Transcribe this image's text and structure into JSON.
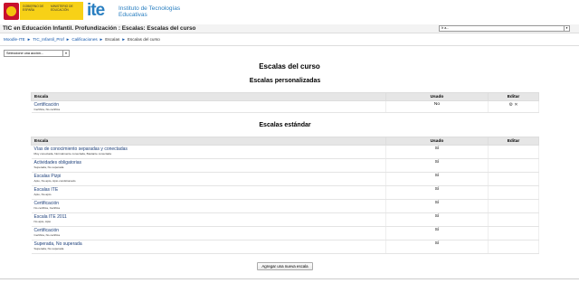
{
  "header": {
    "gov_text": "GOBIERNO DE ESPAÑA",
    "ministry_text": "MINISTERIO DE EDUCACIÓN",
    "logo_text": "ite",
    "logo_subtitle": "Instituto de Tecnologías Educativas",
    "brand_colors": {
      "ite_blue": "#2a7fc1",
      "gov_yellow": "#f7d117",
      "gov_red": "#c8102e"
    }
  },
  "title_bar": {
    "course_title": "TIC en Educación Infantil. Profundización : Escalas: Escalas del curso",
    "jump_select_value": "Ir a..."
  },
  "breadcrumb": {
    "items": [
      "Moodle-ITE",
      "TIC_Infantil_Prof",
      "Calificaciones",
      "Escalas",
      "Escalas del curso"
    ],
    "separator": "►"
  },
  "action_select": {
    "value": "Seleccione una acción..."
  },
  "main": {
    "page_heading": "Escalas del curso",
    "custom_heading": "Escalas personalizadas",
    "standard_heading": "Escalas estándar",
    "columns": {
      "name": "Escala",
      "used": "Usado",
      "edit": "Editar"
    },
    "custom_scales": [
      {
        "name": "Certificación",
        "items": "Certifica, No certifica",
        "used": "No",
        "edit": "⚙ ✕"
      }
    ],
    "standard_scales": [
      {
        "name": "Vías de conocimiento separadas y conectadas",
        "items": "Muy conectada, Normalmente conectada, Bastante conectada",
        "used": "Sí"
      },
      {
        "name": "Actividades obligatorias",
        "items": "Superada, No superada",
        "used": "Sí"
      },
      {
        "name": "Escalas Pizpi",
        "items": "Apto, No apto, Apto condicionado",
        "used": "Sí"
      },
      {
        "name": "Escalas ITE",
        "items": "Apto, No apto",
        "used": "Sí"
      },
      {
        "name": "Certificación",
        "items": "No certifica, Certifica",
        "used": "Sí"
      },
      {
        "name": "Escala ITE 2011",
        "items": "No apto, Apto",
        "used": "Sí"
      },
      {
        "name": "Certificación",
        "items": "Certifica, No certifica",
        "used": "Sí"
      },
      {
        "name": "Superada, No superada",
        "items": "Superada, No superada",
        "used": "Sí"
      }
    ],
    "add_button": "Agregar una nueva escala"
  }
}
